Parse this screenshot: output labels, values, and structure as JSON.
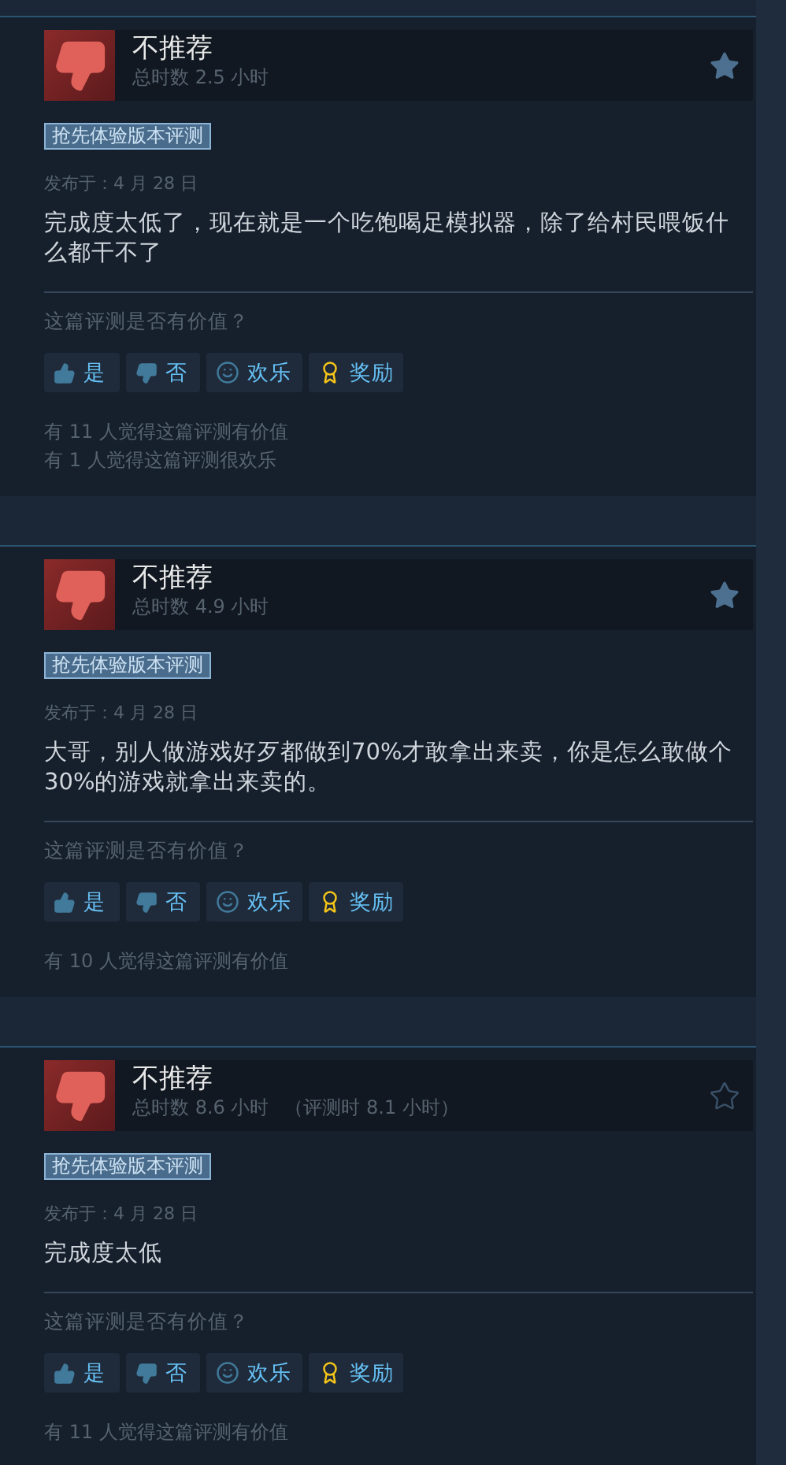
{
  "reviews": [
    {
      "verdict": "不推荐",
      "hours": "总时数 2.5 小时",
      "starred": true,
      "tag": "抢先体验版本评测",
      "date": "发布于：4 月 28 日",
      "body": "完成度太低了，现在就是一个吃饱喝足模拟器，除了给村民喂饭什么都干不了",
      "question": "这篇评测是否有价值？",
      "buttons": [
        {
          "kind": "yes",
          "label": "是"
        },
        {
          "kind": "no",
          "label": "否"
        },
        {
          "kind": "funny",
          "label": "欢乐"
        },
        {
          "kind": "award",
          "label": "奖励"
        }
      ],
      "stats": [
        "有 11 人觉得这篇评测有价值",
        "有 1 人觉得这篇评测很欢乐"
      ]
    },
    {
      "verdict": "不推荐",
      "hours": "总时数 4.9 小时",
      "starred": true,
      "tag": "抢先体验版本评测",
      "date": "发布于：4 月 28 日",
      "body": "大哥，别人做游戏好歹都做到70%才敢拿出来卖，你是怎么敢做个30%的游戏就拿出来卖的。",
      "question": "这篇评测是否有价值？",
      "buttons": [
        {
          "kind": "yes",
          "label": "是"
        },
        {
          "kind": "no",
          "label": "否"
        },
        {
          "kind": "funny",
          "label": "欢乐"
        },
        {
          "kind": "award",
          "label": "奖励"
        }
      ],
      "stats": [
        "有 10 人觉得这篇评测有价值"
      ]
    },
    {
      "verdict": "不推荐",
      "hours": "总时数 8.6 小时",
      "review_hours": "（评测时 8.1 小时）",
      "starred": false,
      "tag": "抢先体验版本评测",
      "date": "发布于：4 月 28 日",
      "body": "完成度太低",
      "question": "这篇评测是否有价值？",
      "buttons": [
        {
          "kind": "yes",
          "label": "是"
        },
        {
          "kind": "no",
          "label": "否"
        },
        {
          "kind": "funny",
          "label": "欢乐"
        },
        {
          "kind": "award",
          "label": "奖励"
        }
      ],
      "stats": [
        "有 11 人觉得这篇评测有价值"
      ]
    }
  ]
}
